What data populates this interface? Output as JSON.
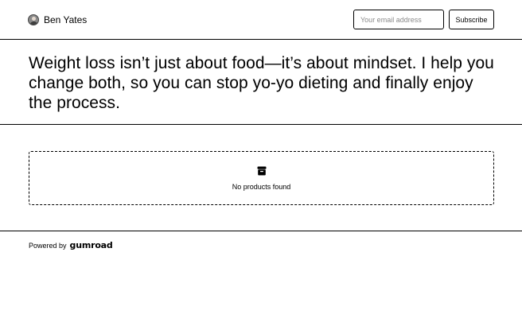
{
  "header": {
    "creator_name": "Ben Yates",
    "email_placeholder": "Your email address",
    "subscribe_label": "Subscribe"
  },
  "hero": {
    "bio": "Weight loss isn’t just about food—it’s about mindset. I help you change both, so you can stop yo-yo dieting and finally enjoy the process."
  },
  "products": {
    "empty_icon": "archive-box-icon",
    "empty_text": "No products found"
  },
  "footer": {
    "powered_by": "Powered by",
    "brand": "GUMROAD"
  }
}
